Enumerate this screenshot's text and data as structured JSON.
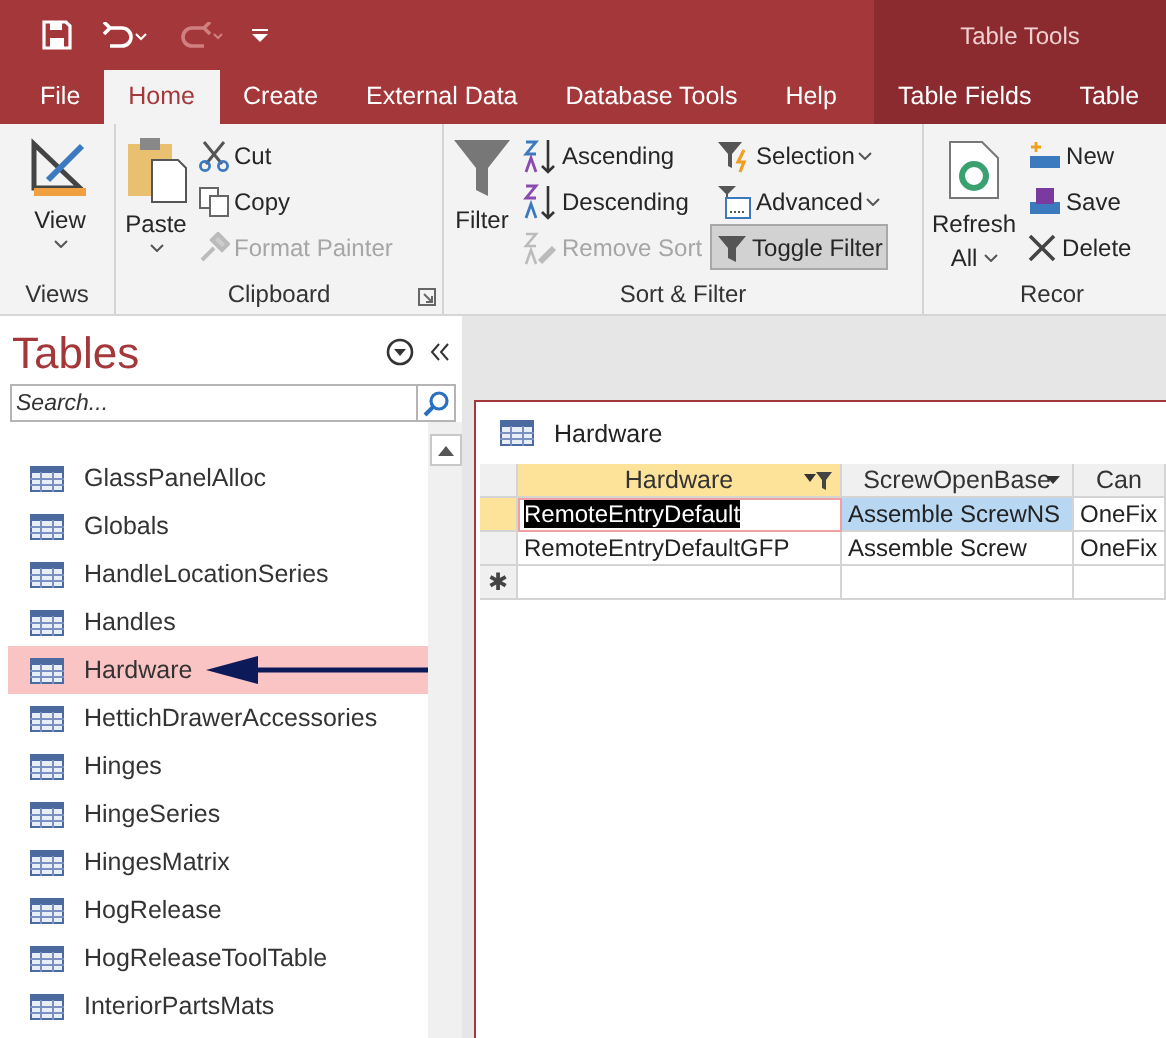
{
  "title_bar": {
    "contextual_label": "Table Tools"
  },
  "ribbon_tabs": [
    {
      "label": "File",
      "selected": false,
      "contextual": false
    },
    {
      "label": "Home",
      "selected": true,
      "contextual": false
    },
    {
      "label": "Create",
      "selected": false,
      "contextual": false
    },
    {
      "label": "External Data",
      "selected": false,
      "contextual": false
    },
    {
      "label": "Database Tools",
      "selected": false,
      "contextual": false
    },
    {
      "label": "Help",
      "selected": false,
      "contextual": false
    },
    {
      "label": "Table Fields",
      "selected": false,
      "contextual": true
    },
    {
      "label": "Table",
      "selected": false,
      "contextual": true
    }
  ],
  "ribbon_groups": [
    {
      "label": "Views",
      "launcher": false,
      "commands": [
        {
          "kind": "large",
          "label": "View",
          "dropdown": true,
          "disabled": false,
          "pressed": false
        }
      ]
    },
    {
      "label": "Clipboard",
      "launcher": true,
      "commands": [
        {
          "kind": "large",
          "label": "Paste",
          "dropdown": true,
          "disabled": false,
          "pressed": false
        },
        {
          "kind": "small",
          "label": "Cut",
          "dropdown": false,
          "disabled": false,
          "pressed": false
        },
        {
          "kind": "small",
          "label": "Copy",
          "dropdown": false,
          "disabled": false,
          "pressed": false
        },
        {
          "kind": "small",
          "label": "Format Painter",
          "dropdown": false,
          "disabled": true,
          "pressed": false
        }
      ]
    },
    {
      "label": "Sort & Filter",
      "launcher": false,
      "commands": [
        {
          "kind": "large",
          "label": "Filter",
          "dropdown": false,
          "disabled": false,
          "pressed": false
        },
        {
          "kind": "small",
          "label": "Ascending",
          "dropdown": false,
          "disabled": false,
          "pressed": false
        },
        {
          "kind": "small",
          "label": "Descending",
          "dropdown": false,
          "disabled": false,
          "pressed": false
        },
        {
          "kind": "small",
          "label": "Remove Sort",
          "dropdown": false,
          "disabled": true,
          "pressed": false
        },
        {
          "kind": "small",
          "label": "Selection",
          "dropdown": true,
          "disabled": false,
          "pressed": false
        },
        {
          "kind": "small",
          "label": "Advanced",
          "dropdown": true,
          "disabled": false,
          "pressed": false
        },
        {
          "kind": "small",
          "label": "Toggle Filter",
          "dropdown": false,
          "disabled": false,
          "pressed": true
        }
      ]
    },
    {
      "label": "Recor",
      "launcher": false,
      "commands": [
        {
          "kind": "large",
          "label": "Refresh",
          "label_2": "All",
          "dropdown": true,
          "disabled": false,
          "pressed": false
        },
        {
          "kind": "small",
          "label": "New",
          "dropdown": false,
          "disabled": false,
          "pressed": false
        },
        {
          "kind": "small",
          "label": "Save",
          "dropdown": false,
          "disabled": false,
          "pressed": false
        },
        {
          "kind": "small",
          "label": "Delete",
          "dropdown": false,
          "disabled": false,
          "pressed": false
        }
      ]
    }
  ],
  "navigation_pane": {
    "title": "Tables",
    "search": {
      "placeholder": "Search..."
    },
    "items": [
      {
        "label": "GlassPanelAlloc",
        "selected": false
      },
      {
        "label": "Globals",
        "selected": false
      },
      {
        "label": "HandleLocationSeries",
        "selected": false
      },
      {
        "label": "Handles",
        "selected": false
      },
      {
        "label": "Hardware",
        "selected": true
      },
      {
        "label": "HettichDrawerAccessories",
        "selected": false
      },
      {
        "label": "Hinges",
        "selected": false
      },
      {
        "label": "HingeSeries",
        "selected": false
      },
      {
        "label": "HingesMatrix",
        "selected": false
      },
      {
        "label": "HogRelease",
        "selected": false
      },
      {
        "label": "HogReleaseToolTable",
        "selected": false
      },
      {
        "label": "InteriorPartsMats",
        "selected": false
      }
    ]
  },
  "document": {
    "title": "Hardware",
    "columns": [
      {
        "label": "Hardware",
        "selected": true,
        "filtered": true,
        "dropdown": false
      },
      {
        "label": "ScrewOpenBase",
        "selected": false,
        "filtered": false,
        "dropdown": true
      },
      {
        "label": "Can",
        "selected": false,
        "filtered": false,
        "dropdown": false
      }
    ],
    "rows": [
      {
        "current": true,
        "cells": [
          {
            "text": "RemoteEntryDefault",
            "editing": true,
            "selected": false
          },
          {
            "text": "Assemble ScrewNS",
            "editing": false,
            "selected": true
          },
          {
            "text": "OneFix",
            "editing": false,
            "selected": false
          }
        ]
      },
      {
        "current": false,
        "cells": [
          {
            "text": "RemoteEntryDefaultGFP",
            "editing": false,
            "selected": false
          },
          {
            "text": "Assemble Screw",
            "editing": false,
            "selected": false
          },
          {
            "text": "OneFix",
            "editing": false,
            "selected": false
          }
        ]
      }
    ],
    "new_row_marker": "✱"
  }
}
